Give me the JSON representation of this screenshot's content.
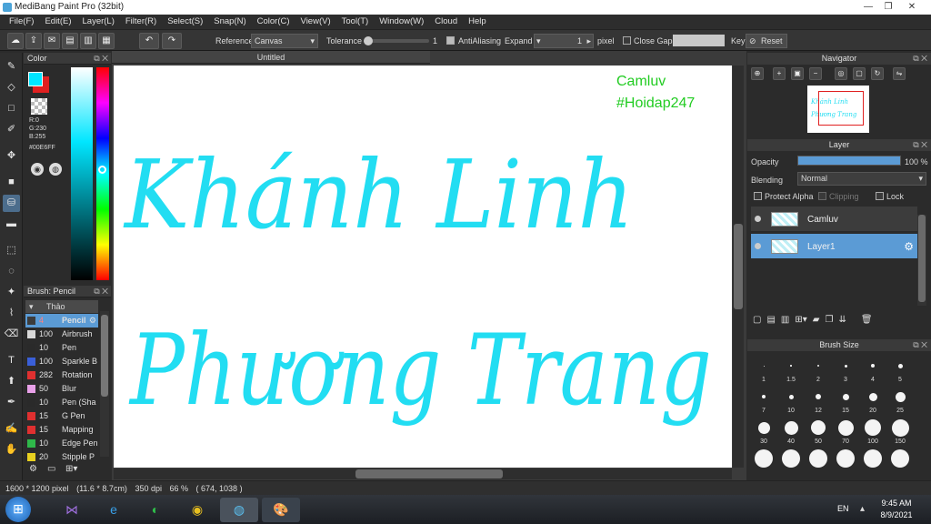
{
  "window": {
    "title": "MediBang Paint Pro (32bit)",
    "minimize": "—",
    "maximize": "❐",
    "close": "✕"
  },
  "menu": [
    "File(F)",
    "Edit(E)",
    "Layer(L)",
    "Filter(R)",
    "Select(S)",
    "Snap(N)",
    "Color(C)",
    "View(V)",
    "Tool(T)",
    "Window(W)",
    "Cloud",
    "Help"
  ],
  "toolbar": {
    "reference_label": "Reference",
    "reference_value": "Canvas",
    "tolerance_label": "Tolerance",
    "tolerance_value": "1",
    "antialiasing_label": "AntiAliasing",
    "expand_label": "Expand",
    "expand_value": "1",
    "expand_unit": "pixel",
    "close_gaps_label": "Close Gaps",
    "key_label": "Key",
    "reset_label": "Reset"
  },
  "color_panel": {
    "title": "Color",
    "r": "R:0",
    "g": "G:230",
    "b": "B:255",
    "hex": "#00E6FF",
    "foreground": "#00E6FF",
    "background": "#E02020"
  },
  "brush_panel": {
    "title": "Brush: Pencil",
    "group": "Thảo",
    "items": [
      {
        "size": "4",
        "name": "Pencil",
        "color": "#3c3c3c",
        "active": true
      },
      {
        "size": "100",
        "name": "Airbrush",
        "color": "#d8d8d8"
      },
      {
        "size": "10",
        "name": "Pen",
        "color": "#2a2a2a"
      },
      {
        "size": "100",
        "name": "Sparkle B",
        "color": "#3a5fd8"
      },
      {
        "size": "282",
        "name": "Rotation",
        "color": "#e03030"
      },
      {
        "size": "50",
        "name": "Blur",
        "color": "#e8a0e8"
      },
      {
        "size": "10",
        "name": "Pen (Sha",
        "color": "#2a2a2a"
      },
      {
        "size": "15",
        "name": "G Pen",
        "color": "#e03030"
      },
      {
        "size": "15",
        "name": "Mapping",
        "color": "#e03030"
      },
      {
        "size": "10",
        "name": "Edge Pen",
        "color": "#2fb84a"
      },
      {
        "size": "20",
        "name": "Stipple P",
        "color": "#e8d020"
      }
    ]
  },
  "document": {
    "tab_title": "Untitled",
    "lettering_line1": "Khánh Linh",
    "lettering_line2": "Phương Trang",
    "note_line1": "Camluv",
    "note_line2": "#Hoidap247",
    "text_color": "#22DDF2",
    "note_color": "#22CC22"
  },
  "navigator": {
    "title": "Navigator"
  },
  "layer_panel": {
    "title": "Layer",
    "opacity_label": "Opacity",
    "opacity_value": "100 %",
    "opacity_fraction": 1.0,
    "blending_label": "Blending",
    "blending_value": "Normal",
    "protect_alpha": "Protect Alpha",
    "clipping": "Clipping",
    "lock": "Lock",
    "layers": [
      {
        "name": "Camluv",
        "selected": false
      },
      {
        "name": "Layer1",
        "selected": true
      }
    ]
  },
  "brush_size_panel": {
    "title": "Brush Size",
    "sizes": [
      "1",
      "1.5",
      "2",
      "3",
      "4",
      "5",
      "7",
      "10",
      "12",
      "15",
      "20",
      "25",
      "30",
      "40",
      "50",
      "70",
      "100",
      "150"
    ]
  },
  "status": {
    "dimensions": "1600 * 1200 pixel",
    "physical": "(11.6 * 8.7cm)",
    "dpi": "350 dpi",
    "zoom": "66 %",
    "coords": "( 674, 1038 )"
  },
  "taskbar": {
    "lang": "EN",
    "time": "9:45 AM",
    "date": "8/9/2021"
  }
}
